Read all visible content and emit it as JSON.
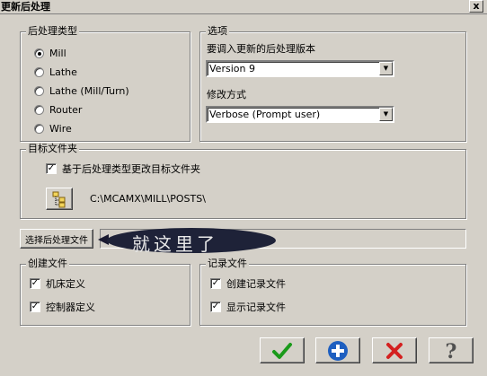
{
  "window": {
    "title": "更新后处理",
    "close_label": "x"
  },
  "post_type": {
    "legend": "后处理类型",
    "options": [
      "Mill",
      "Lathe",
      "Lathe (Mill/Turn)",
      "Router",
      "Wire"
    ],
    "selected": "Mill"
  },
  "options_group": {
    "legend": "选项",
    "version_label": "要调入更新的后处理版本",
    "version_value": "Version 9",
    "mode_label": "修改方式",
    "mode_value": "Verbose (Prompt user)"
  },
  "target_folder": {
    "legend": "目标文件夹",
    "checkbox_label": "基于后处理类型更改目标文件夹",
    "checked": true,
    "path": "C:\\MCAMX\\MILL\\POSTS\\"
  },
  "select_post": {
    "button_label": "选择后处理文件",
    "annotation": "就这里了"
  },
  "create_files": {
    "legend": "创建文件",
    "items": [
      {
        "label": "机床定义",
        "checked": true
      },
      {
        "label": "控制器定义",
        "checked": true
      }
    ]
  },
  "log_files": {
    "legend": "记录文件",
    "items": [
      {
        "label": "创建记录文件",
        "checked": true
      },
      {
        "label": "显示记录文件",
        "checked": true
      }
    ]
  },
  "colors": {
    "ok_green": "#1a9a1a",
    "add_blue": "#1e5fc0",
    "cancel_red": "#d42020",
    "help_gray": "#505050"
  },
  "icons": [
    "close-icon",
    "folder-tree-icon",
    "ok-check-icon",
    "add-plus-icon",
    "cancel-x-icon",
    "help-question-icon"
  ]
}
